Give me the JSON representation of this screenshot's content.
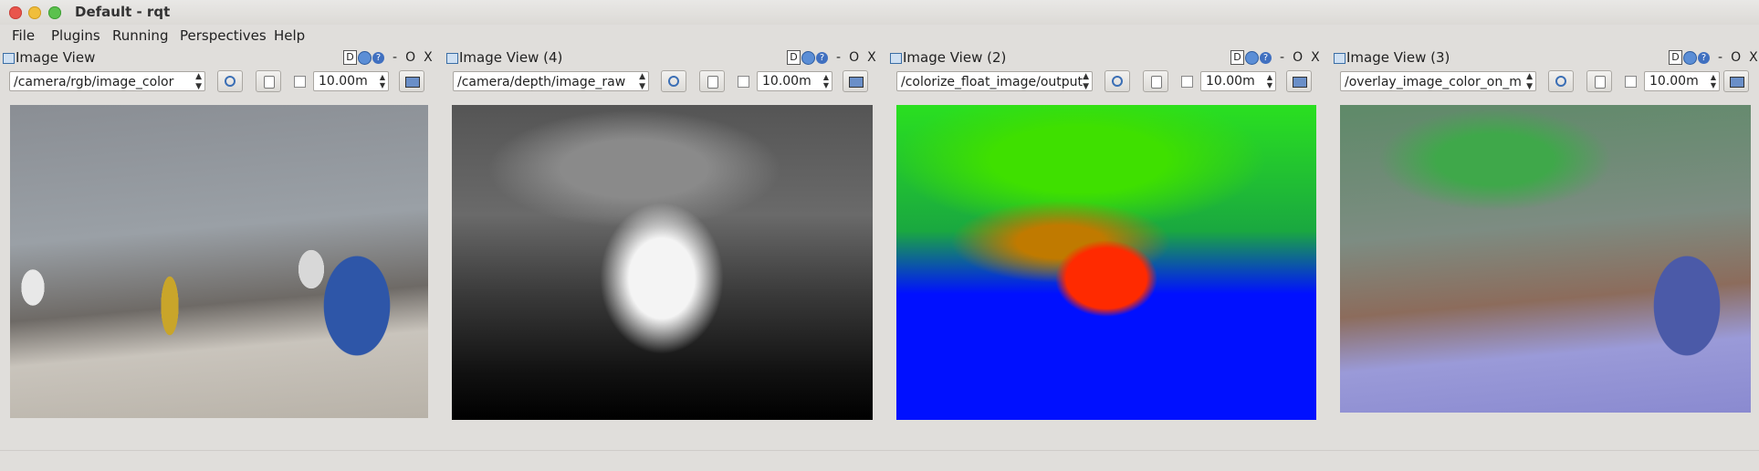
{
  "window": {
    "title": "Default - rqt"
  },
  "menubar": {
    "items": [
      "File",
      "Plugins",
      "Running",
      "Perspectives",
      "Help"
    ]
  },
  "panels": [
    {
      "title": "Image View",
      "topic": "/camera/rgb/image_color",
      "timeout": "10.00m",
      "dmark": "D",
      "min": "-",
      "restore": "O",
      "close": "X"
    },
    {
      "title": "Image View (4)",
      "topic": "/camera/depth/image_raw",
      "timeout": "10.00m",
      "dmark": "D",
      "min": "-",
      "restore": "O",
      "close": "X"
    },
    {
      "title": "Image View (2)",
      "topic": "/colorize_float_image/output",
      "timeout": "10.00m",
      "dmark": "D",
      "min": "-",
      "restore": "O",
      "close": "X"
    },
    {
      "title": "Image View (3)",
      "topic": "/overlay_image_color_on_m",
      "timeout": "10.00m",
      "dmark": "D",
      "min": "-",
      "restore": "O",
      "close": "X"
    }
  ],
  "icons": {
    "refresh": "refresh-icon",
    "help": "help-icon",
    "save": "save-image-icon"
  }
}
